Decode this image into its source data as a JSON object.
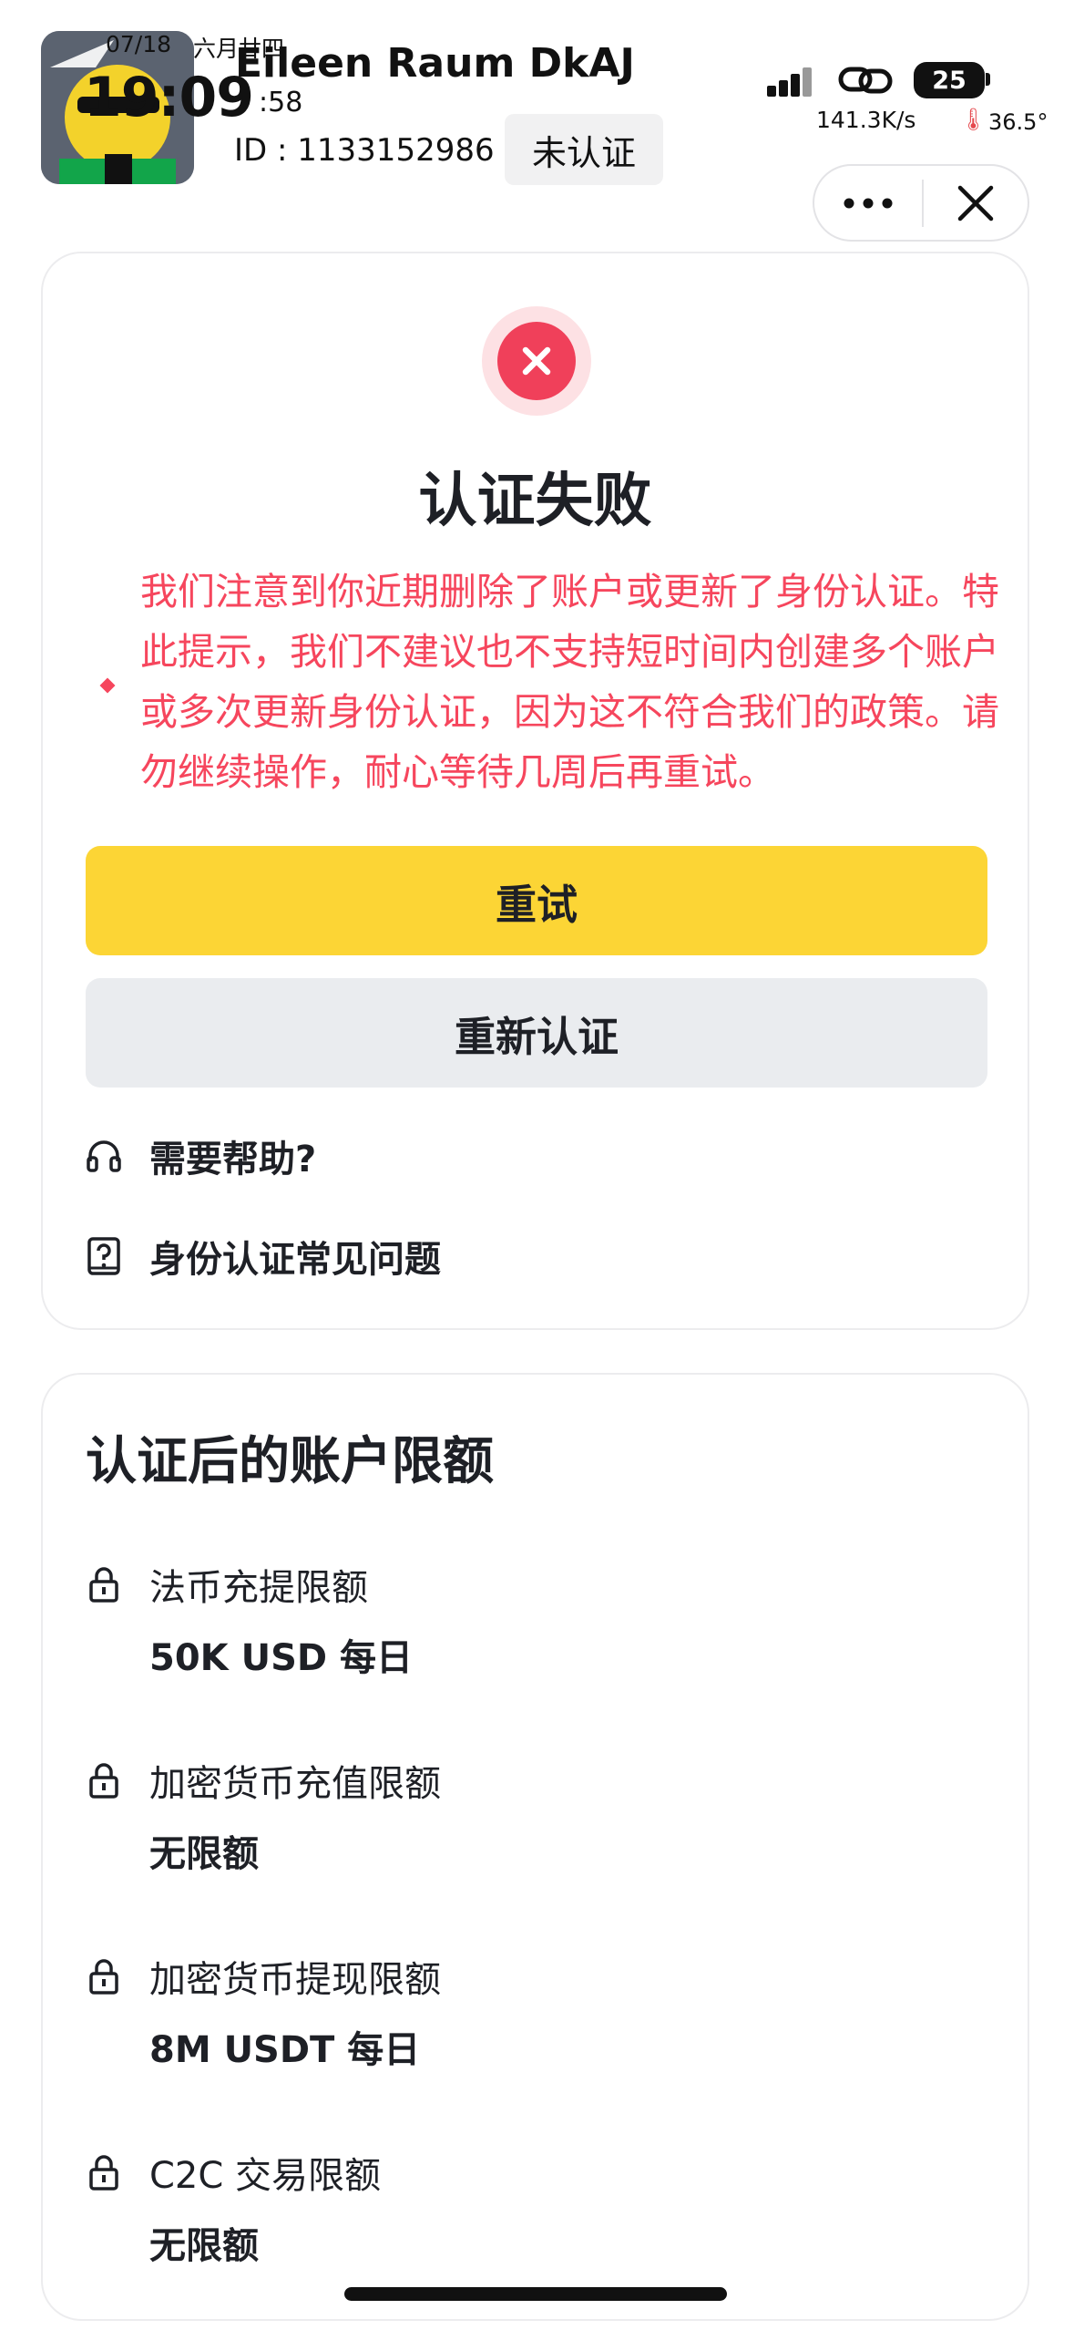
{
  "status_bar": {
    "date": "07/18",
    "lunar": "六月廿四",
    "time": "19:09",
    "seconds": ":58",
    "battery": "25",
    "net_speed": "141.3K/s",
    "temperature": "36.5°"
  },
  "header": {
    "user_name": "Eileen Raum DkAJ",
    "user_id": "ID : 1133152986",
    "verify_status": "未认证"
  },
  "result": {
    "title": "认证失败",
    "message": "我们注意到你近期删除了账户或更新了身份认证。特此提示，我们不建议也不支持短时间内创建多个账户或多次更新身份认证，因为这不符合我们的政策。请勿继续操作，耐心等待几周后再重试。",
    "retry_label": "重试",
    "reverify_label": "重新认证"
  },
  "help": {
    "need_help": "需要帮助?",
    "faq": "身份认证常见问题"
  },
  "limits": {
    "title": "认证后的账户限额",
    "items": [
      {
        "label": "法币充提限额",
        "value": "50K USD 每日"
      },
      {
        "label": "加密货币充值限额",
        "value": "无限额"
      },
      {
        "label": "加密货币提现限额",
        "value": "8M USDT 每日"
      },
      {
        "label": "C2C 交易限额",
        "value": "无限额"
      }
    ]
  },
  "colors": {
    "accent_yellow": "#fcd535",
    "error_red": "#f6465d",
    "text_dark": "#1e2026"
  }
}
